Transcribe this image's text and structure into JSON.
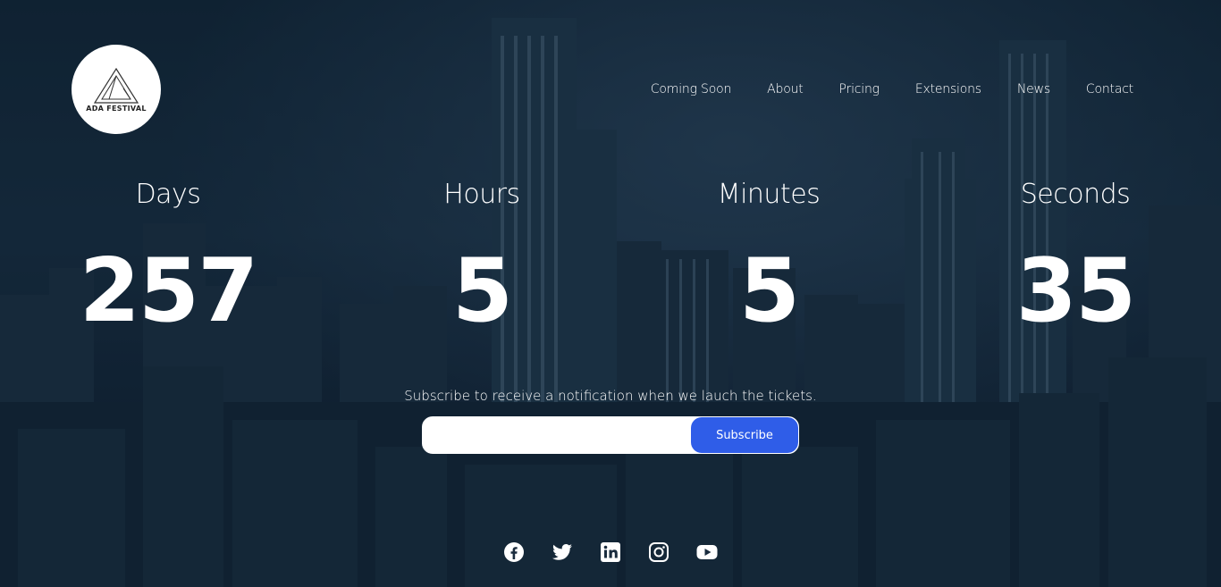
{
  "brand": {
    "logo_text": "ADA FESTIVAL"
  },
  "nav": {
    "items": [
      {
        "label": "Coming Soon"
      },
      {
        "label": "About"
      },
      {
        "label": "Pricing"
      },
      {
        "label": "Extensions"
      },
      {
        "label": "News"
      },
      {
        "label": "Contact"
      }
    ]
  },
  "countdown": {
    "days": {
      "label": "Days",
      "value": "257"
    },
    "hours": {
      "label": "Hours",
      "value": "5"
    },
    "minutes": {
      "label": "Minutes",
      "value": "5"
    },
    "seconds": {
      "label": "Seconds",
      "value": "35"
    }
  },
  "subscribe": {
    "text": "Subscribe to receive a notification when we lauch the tickets.",
    "placeholder": "",
    "button_label": "Subscribe",
    "button_color": "#2f5de8"
  },
  "social": {
    "icons": [
      "facebook-icon",
      "twitter-icon",
      "linkedin-icon",
      "instagram-icon",
      "youtube-icon"
    ]
  }
}
